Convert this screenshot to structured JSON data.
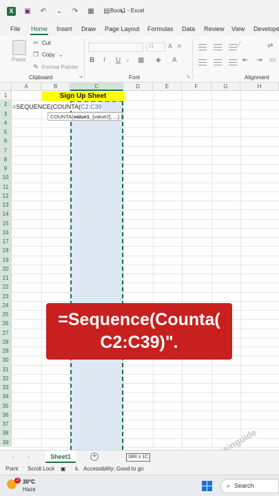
{
  "titlebar": {
    "doc_title": "Book1  -  Excel",
    "app_icon": "excel-icon"
  },
  "tabs": [
    "File",
    "Home",
    "Insert",
    "Draw",
    "Page Layout",
    "Formulas",
    "Data",
    "Review",
    "View",
    "Develope"
  ],
  "active_tab": "Home",
  "ribbon": {
    "paste": "Paste",
    "cut": "Cut",
    "copy": "Copy",
    "format_painter": "Format Painter",
    "clipboard_group": "Clipboard",
    "font_group": "Font",
    "alignment_group": "Alignment",
    "font_size": "11",
    "bold": "B",
    "italic": "I",
    "underline": "U",
    "wrap_label": "W"
  },
  "columns": [
    "A",
    "B",
    "C",
    "D",
    "E",
    "F",
    "G",
    "H"
  ],
  "rows": [
    "1",
    "2",
    "3",
    "4",
    "5",
    "6",
    "7",
    "8",
    "9",
    "10",
    "11",
    "12",
    "13",
    "14",
    "15",
    "16",
    "17",
    "18",
    "19",
    "20",
    "21",
    "22",
    "23",
    "24",
    "25",
    "26",
    "27",
    "28",
    "29",
    "30",
    "31",
    "32",
    "33",
    "34",
    "35",
    "36",
    "37",
    "38",
    "39"
  ],
  "cells": {
    "b1": "Sign Up Sheet",
    "edit_prefix": "=SEQUENCE(COUNTA(",
    "edit_ref": "C2:C39"
  },
  "tooltip": {
    "func": "COUNTA(",
    "arg1": "value1",
    "rest": ", [value2], ...)"
  },
  "banner": {
    "line1": "=Sequence(Counta(",
    "line2": "C2:C39)\"."
  },
  "watermark": "Focusinguide",
  "sheet_tab": "Sheet1",
  "range_size": "38R x 1C",
  "status": {
    "mode": "Point",
    "scroll_lock": "Scroll Lock",
    "accessibility": "Accessibility: Good to go"
  },
  "taskbar": {
    "temperature": "30°C",
    "condition": "Haze",
    "badge": "2",
    "search": "Search"
  },
  "colors": {
    "accent": "#1e7145",
    "banner": "#c8201f",
    "title_fill": "#ffff00",
    "selection_fill": "#dde8f2"
  }
}
